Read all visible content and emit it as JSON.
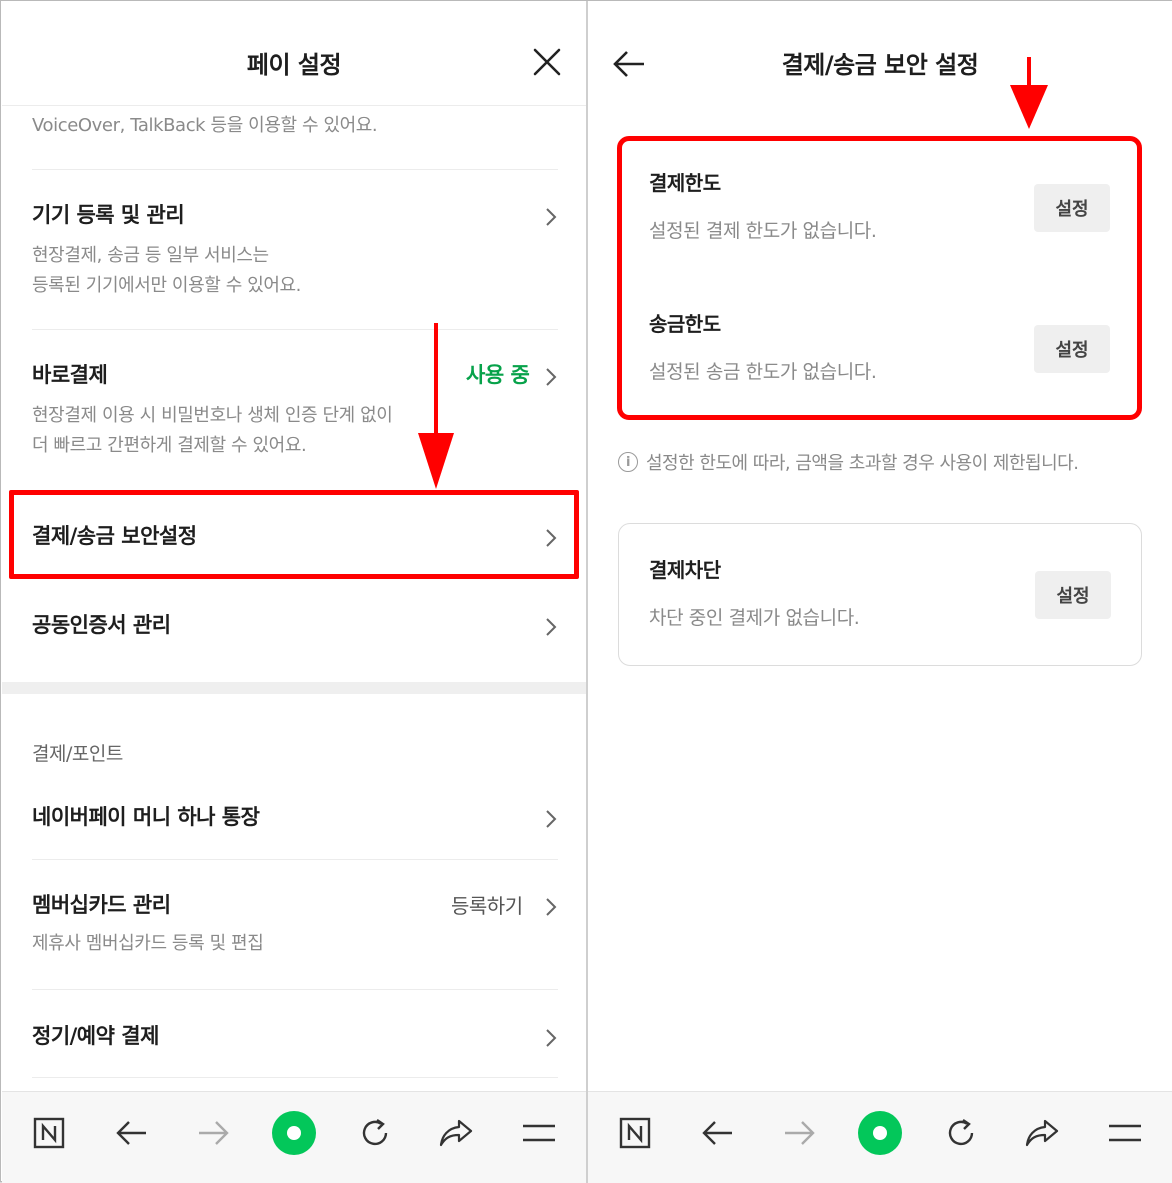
{
  "left": {
    "title": "페이 설정",
    "top_partial_desc": "VoiceOver, TalkBack 등을 이용할 수 있어요.",
    "items": [
      {
        "title": "기기 등록 및 관리",
        "desc1": "현장결제, 송금 등 일부 서비스는",
        "desc2": "등록된 기기에서만 이용할 수 있어요."
      },
      {
        "title": "바로결제",
        "status": "사용 중",
        "desc1": "현장결제 이용 시 비밀번호나 생체 인증 단계 없이",
        "desc2": "더 빠르고 간편하게 결제할 수 있어요."
      },
      {
        "title": "결제/송금 보안설정"
      },
      {
        "title": "공동인증서 관리"
      }
    ],
    "section_label": "결제/포인트",
    "items2": [
      {
        "title": "네이버페이 머니 하나 통장"
      },
      {
        "title": "멤버십카드 관리",
        "status": "등록하기",
        "desc1": "제휴사 멤버십카드 등록 및 편집"
      },
      {
        "title": "정기/예약 결제"
      }
    ]
  },
  "right": {
    "title": "결제/송금 보안 설정",
    "limits": [
      {
        "title": "결제한도",
        "desc": "설정된 결제 한도가 없습니다.",
        "button": "설정"
      },
      {
        "title": "송금한도",
        "desc": "설정된 송금 한도가 없습니다.",
        "button": "설정"
      }
    ],
    "note": "설정한 한도에 따라, 금액을 초과할 경우 사용이 제한됩니다.",
    "block": {
      "title": "결제차단",
      "desc": "차단 중인 결제가 없습니다.",
      "button": "설정"
    }
  },
  "bottom_bar": {
    "icons": [
      "naver-n-icon",
      "back-arrow-icon",
      "forward-arrow-icon",
      "green-home-icon",
      "refresh-icon",
      "share-icon",
      "menu-icon"
    ],
    "accent_color": "#03c75a"
  },
  "colors": {
    "highlight_red": "#ff0000",
    "status_green": "#07a24a"
  }
}
